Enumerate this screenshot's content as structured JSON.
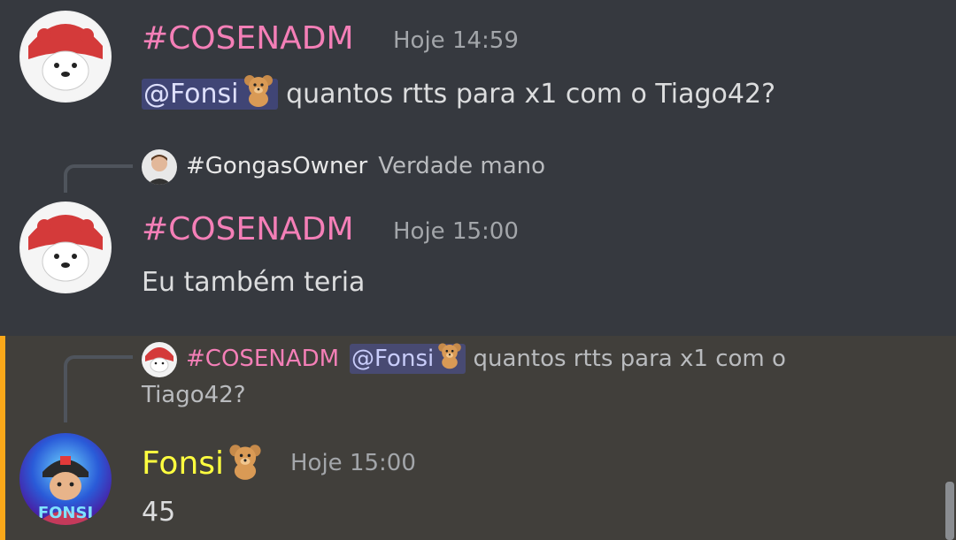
{
  "messages": [
    {
      "author": "#COSENADM",
      "timestamp": "Hoje 14:59",
      "mention": "@Fonsi",
      "mention_emoji": "teddy-bear-icon",
      "text": " quantos rtts para x1 com o Tiago42?"
    },
    {
      "reply": {
        "author": "#GongasOwner",
        "text": "Verdade mano"
      },
      "author": "#COSENADM",
      "timestamp": "Hoje 15:00",
      "text": "Eu também teria"
    },
    {
      "reply": {
        "author": "#COSENADM",
        "mention": "@Fonsi",
        "text_line1": " quantos rtts para x1 com o",
        "text_line2": "Tiago42?"
      },
      "author": "Fonsi",
      "author_emoji": "teddy-bear-icon",
      "timestamp": "Hoje 15:00",
      "text": "45",
      "highlighted": true
    }
  ],
  "colors": {
    "background": "#36393f",
    "highlight_background": "#413f3b",
    "highlight_bar": "#faa81a",
    "author_pink": "#f47fb7",
    "author_yellow": "#ffff3f",
    "mention_bg": "rgba(88,101,242,0.3)"
  }
}
